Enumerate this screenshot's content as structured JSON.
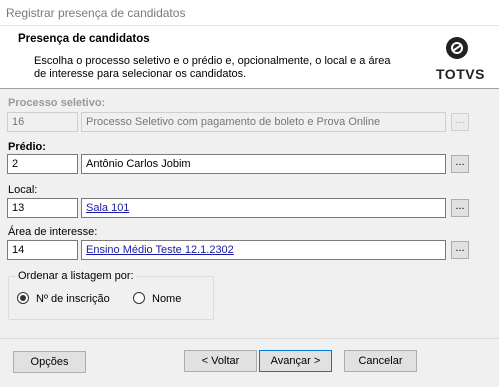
{
  "window": {
    "title": "Registrar presença de candidatos"
  },
  "header": {
    "title": "Presença de candidatos",
    "description": "Escolha o processo seletivo e o prédio e, opcionalmente, o local e a área de interesse para selecionar os candidatos.",
    "logo_text": "TOTVS"
  },
  "form": {
    "processo": {
      "label": "Processo seletivo:",
      "code": "16",
      "name": "Processo Seletivo com pagamento de boleto e Prova Online",
      "lookup": "..."
    },
    "predio": {
      "label": "Prédio:",
      "code": "2",
      "name": "Antônio Carlos Jobim",
      "lookup": "..."
    },
    "local": {
      "label": "Local:",
      "code": "13",
      "name": "Sala 101",
      "lookup": "..."
    },
    "area": {
      "label": "Área de interesse:",
      "code": "14",
      "name": "Ensino Médio Teste 12.1.2302",
      "lookup": "..."
    }
  },
  "ordering": {
    "title": "Ordenar a listagem por:",
    "options": [
      {
        "label": "Nº de inscrição",
        "selected": true
      },
      {
        "label": "Nome",
        "selected": false
      }
    ]
  },
  "buttons": {
    "options": "Opções",
    "back": "< Voltar",
    "next": "Avançar >",
    "cancel": "Cancelar"
  }
}
